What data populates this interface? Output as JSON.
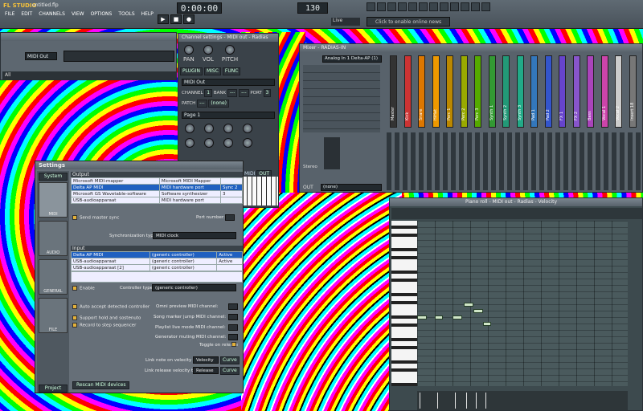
{
  "app": {
    "name": "FL STUDIO",
    "file": "untitled.flp",
    "time": "0:00:00",
    "tempo": "130"
  },
  "menu": [
    "FILE",
    "EDIT",
    "CHANNELS",
    "VIEW",
    "OPTIONS",
    "TOOLS",
    "HELP"
  ],
  "transport": {
    "play": "▶",
    "stop": "■",
    "rec": "●"
  },
  "topbar": {
    "live": "Live",
    "news": "Click to enable online news"
  },
  "step": {
    "channel": "MIDI Out",
    "filter": "All"
  },
  "channel": {
    "title": "Channel settings - MIDI out - Radias",
    "tabs": [
      "PLUGIN",
      "MISC",
      "FUNC"
    ],
    "knob_labels": [
      "PAN",
      "VOL",
      "PITCH"
    ],
    "preset": "MIDI Out",
    "channel_label": "CHANNEL",
    "bank_label": "BANK",
    "port_label": "PORT",
    "channel_val": "1",
    "bank_val": "---",
    "bank_val2": "---",
    "port_val": "3",
    "patch_label": "PATCH",
    "patch_val": "---",
    "patch_name": "(none)",
    "page": "Page 1",
    "midi_label": "MIDI",
    "out_label": "OUT"
  },
  "mixer": {
    "title": "Mixer - RADIAS-IN",
    "input": "Analog In 1 Delta-AP (1)",
    "tracks": [
      "Master",
      "Kick",
      "Snare",
      "HiHat",
      "Perc 1",
      "Perc 2",
      "Perc 3",
      "Synth 1",
      "Synth 2",
      "Synth 3",
      "Pad 1",
      "Pad 2",
      "FX 1",
      "FX 2",
      "Bass",
      "Vocal 1",
      "Vocal 2",
      "Insert 18"
    ],
    "colors": [
      "#333",
      "#c33",
      "#d70",
      "#e90",
      "#b80",
      "#9a0",
      "#5a0",
      "#393",
      "#297",
      "#2a8",
      "#37b",
      "#35c",
      "#64c",
      "#85c",
      "#a4b",
      "#c4a",
      "#ccc",
      "#777"
    ],
    "stereo": "Stereo",
    "out": "OUT",
    "out_val": "(none)"
  },
  "piano": {
    "title": "Piano roll - MIDI out - Radias - Velocity"
  },
  "settings": {
    "title": "Settings",
    "system_tab": "System",
    "side": [
      "MIDI",
      "AUDIO",
      "GENERAL",
      "FILE"
    ],
    "project": "Project",
    "output_label": "Output",
    "output_rows": [
      {
        "name": "Microsoft MIDI-mapper",
        "type": "Microsoft MIDI Mapper",
        "port": ""
      },
      {
        "name": "Delta AP MIDI",
        "type": "MIDI hardware port",
        "port": "Sync 2"
      },
      {
        "name": "Microsoft GS Wavetable-software",
        "type": "Software synthesizer",
        "port": "3"
      },
      {
        "name": "USB-audioapparaat",
        "type": "MIDI hardware port",
        "port": ""
      }
    ],
    "send_sync": "Send master sync",
    "port_number": "Port number:",
    "sync_type_label": "Synchronization type:",
    "sync_type": "MIDI clock",
    "input_label": "Input",
    "input_rows": [
      {
        "name": "Delta AP MIDI",
        "type": "(generic controller)",
        "state": "Active"
      },
      {
        "name": "USB-audioapparaat",
        "type": "(generic controller)",
        "state": "Active"
      },
      {
        "name": "USB-audioapparaat [2]",
        "type": "(generic controller)",
        "state": ""
      }
    ],
    "enable": "Enable",
    "controller_label": "Controller type:",
    "controller": "(generic controller)",
    "auto_accept": "Auto accept detected controller",
    "support_hold": "Support hold and sostenuto",
    "record_step": "Record to step sequencer",
    "omni": "Omni preview MIDI channel:",
    "song_marker": "Song marker jump MIDI channel:",
    "playlist": "Playlist live mode MIDI channel:",
    "generator": "Generator muting MIDI channel:",
    "toggle": "Toggle on release",
    "note_on": "Link note on velocity to:",
    "note_on_val": "Velocity",
    "release": "Link release velocity to:",
    "release_val": "Release",
    "curve": "Curve",
    "rescan": "Rescan MIDI devices"
  }
}
